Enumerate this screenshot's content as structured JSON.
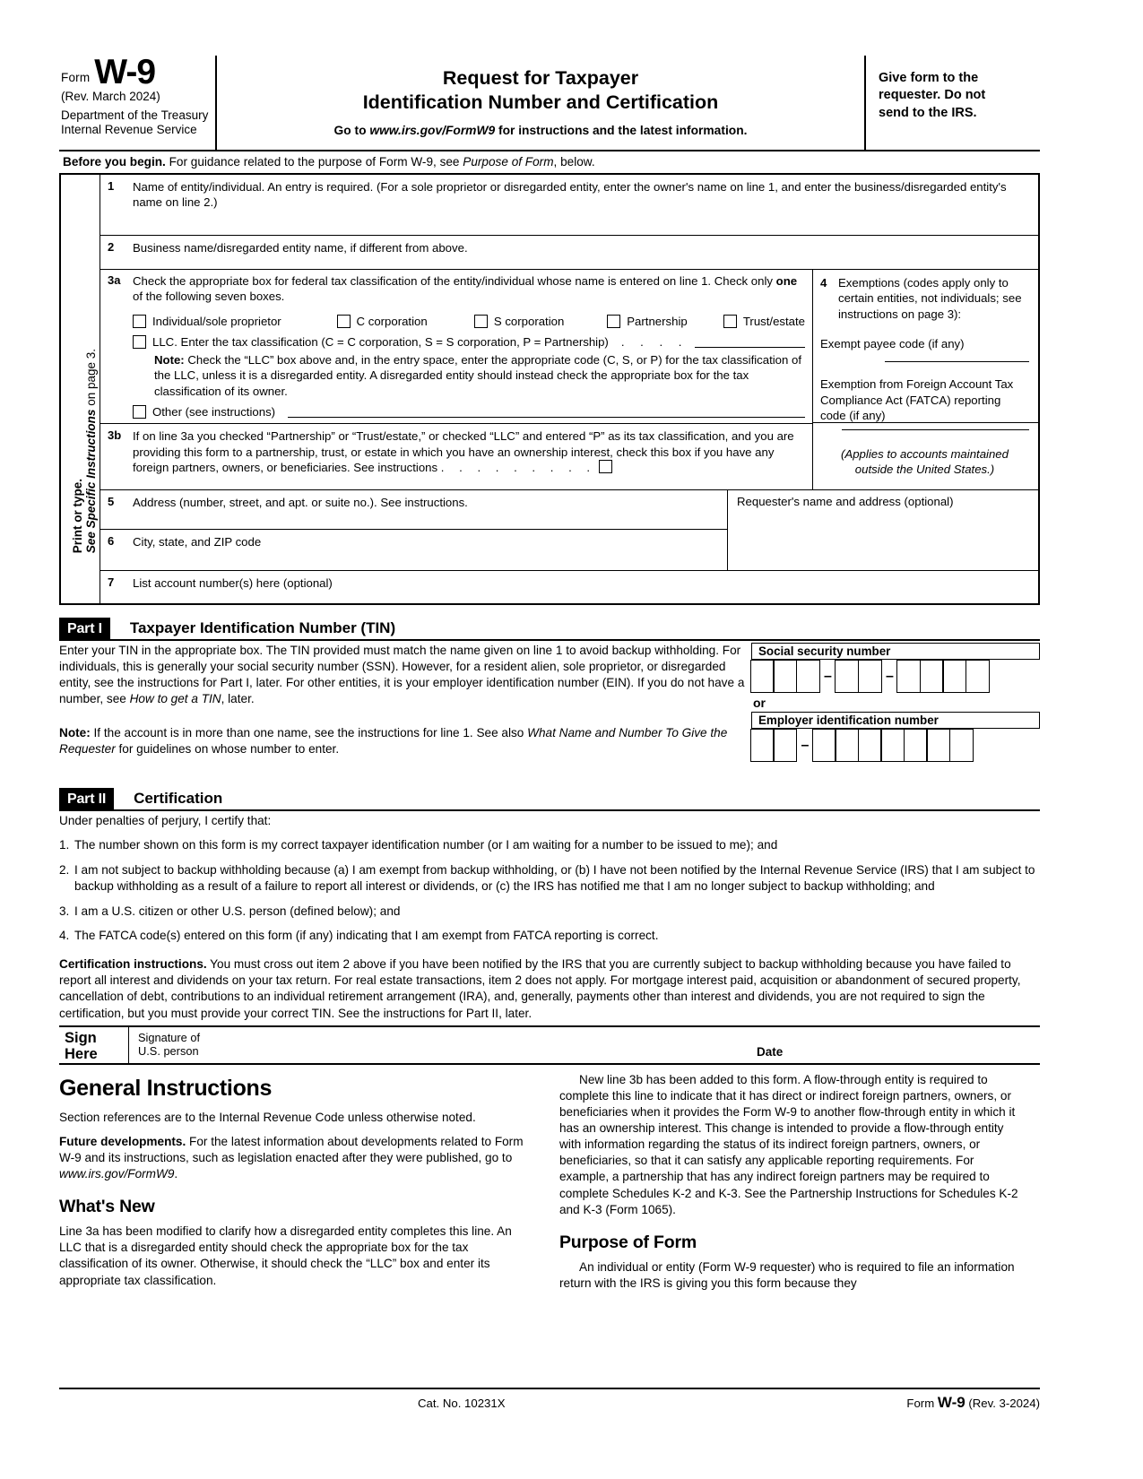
{
  "header": {
    "form_word": "Form",
    "form_number": "W-9",
    "revision": "(Rev. March 2024)",
    "dept_line1": "Department of the Treasury",
    "dept_line2": "Internal Revenue Service",
    "title_line1": "Request for Taxpayer",
    "title_line2": "Identification Number and Certification",
    "goto_prefix": "Go to ",
    "goto_url": "www.irs.gov/FormW9",
    "goto_suffix": " for instructions and the latest information.",
    "give_form_line1": "Give form to the",
    "give_form_line2": "requester. Do not",
    "give_form_line3": "send to the IRS."
  },
  "before_begin": {
    "bold": "Before you begin.",
    "text1": " For guidance related to the purpose of Form W-9, see ",
    "italic": "Purpose of Form",
    "text2": ", below."
  },
  "sidebar": {
    "line1": "Print or type.",
    "line2_italic": "See Specific Instructions",
    "line2_rest": " on page 3."
  },
  "lines": {
    "line1_num": "1",
    "line1_text": "Name of entity/individual. An entry is required. (For a sole proprietor or disregarded entity, enter the owner's name on line 1, and enter the business/disregarded entity's name on line 2.)",
    "line2_num": "2",
    "line2_text": "Business name/disregarded entity name, if different from above.",
    "line3a_num": "3a",
    "line3a_text_pre": "Check the appropriate box for federal tax classification of the entity/individual whose name is entered on line 1. Check only ",
    "line3a_bold": "one",
    "line3a_text_post": " of the following seven boxes.",
    "checkboxes": [
      {
        "label": "Individual/sole proprietor"
      },
      {
        "label": "C corporation"
      },
      {
        "label": "S corporation"
      },
      {
        "label": "Partnership"
      },
      {
        "label": "Trust/estate"
      }
    ],
    "llc_label": "LLC. Enter the tax classification (C = C corporation, S = S corporation, P = Partnership)",
    "llc_dots": ".    .    .    .",
    "note_bold": "Note:",
    "note_text": " Check the “LLC” box above and, in the entry space, enter the appropriate code (C, S, or P) for the tax classification of the LLC, unless it is a disregarded entity. A disregarded entity should instead check the appropriate box for the tax classification of its owner.",
    "other_label": "Other (see instructions)",
    "line3b_num": "3b",
    "line3b_text": "If on line 3a you checked “Partnership” or “Trust/estate,” or checked “LLC” and entered “P” as its tax classification, and you are providing this form to a partnership, trust, or estate in which you have an ownership interest, check this box if you have any foreign partners, owners, or beneficiaries. See instructions",
    "line3b_dots": ".    .    .    .    .    .    .    .    .",
    "line5_num": "5",
    "line5_text": "Address (number, street, and apt. or suite no.). See instructions.",
    "line6_num": "6",
    "line6_text": "City, state, and ZIP code",
    "line7_num": "7",
    "line7_text": "List account number(s) here (optional)",
    "requester_label": "Requester's name and address (optional)"
  },
  "exemptions": {
    "num": "4",
    "title": "Exemptions (codes apply only to certain entities, not individuals; see instructions on page 3):",
    "payee_code_label": "Exempt payee code (if any)",
    "fatca_label": "Exemption from Foreign Account Tax Compliance Act (FATCA) reporting code (if any)",
    "applies_line1": "(Applies to accounts maintained",
    "applies_line2": "outside the United States.)"
  },
  "part1": {
    "badge": "Part I",
    "title": "Taxpayer Identification Number (TIN)",
    "body_pre": "Enter your TIN in the appropriate box. The TIN provided must match the name given on line 1 to avoid backup withholding. For individuals, this is generally your social security number (SSN). However, for a resident alien, sole proprietor, or disregarded entity, see the instructions for Part I, later. For other entities, it is your employer identification number (EIN). If you do not have a number, see ",
    "body_italic": "How to get a TIN",
    "body_post": ", later.",
    "note_bold": "Note:",
    "note_pre": " If the account is in more than one name, see the instructions for line 1. See also ",
    "note_italic": "What Name and Number To Give the Requester",
    "note_post": " for guidelines on whose number to enter.",
    "ssn_label": "Social security number",
    "or_label": "or",
    "ein_label": "Employer identification number"
  },
  "part2": {
    "badge": "Part II",
    "title": "Certification",
    "intro": "Under penalties of perjury, I certify that:",
    "items": [
      {
        "num": "1.",
        "text": "The number shown on this form is my correct taxpayer identification number (or I am waiting for a number to be issued to me); and"
      },
      {
        "num": "2.",
        "text": "I am not subject to backup withholding because (a) I am exempt from backup withholding, or (b) I have not been notified by the Internal Revenue Service (IRS) that I am subject to backup withholding as a result of a failure to report all interest or dividends, or (c) the IRS has notified me that I am no longer subject to backup withholding; and"
      },
      {
        "num": "3.",
        "text": "I am a U.S. citizen or other U.S. person (defined below); and"
      },
      {
        "num": "4.",
        "text": "The FATCA code(s) entered on this form (if any) indicating that I am exempt from FATCA reporting is correct."
      }
    ],
    "cert_bold": "Certification instructions.",
    "cert_text": " You must cross out item 2 above if you have been notified by the IRS that you are currently subject to backup withholding because you have failed to report all interest and dividends on your tax return. For real estate transactions, item 2 does not apply. For mortgage interest paid, acquisition or abandonment of secured property, cancellation of debt, contributions to an individual retirement arrangement (IRA), and, generally, payments other than interest and dividends, you are not required to sign the certification, but you must provide your correct TIN. See the instructions for Part II, later."
  },
  "sign": {
    "sign_line1": "Sign",
    "sign_line2": "Here",
    "sig_line1": "Signature of",
    "sig_line2": "U.S. person",
    "date_label": "Date"
  },
  "instructions": {
    "general_heading": "General Instructions",
    "section_refs": "Section references are to the Internal Revenue Code unless otherwise noted.",
    "future_bold": "Future developments.",
    "future_pre": " For the latest information about developments related to Form W-9 and its instructions, such as legislation enacted after they were published, go to ",
    "future_italic": "www.irs.gov/FormW9",
    "future_post": ".",
    "whatsnew_heading": "What's New",
    "whatsnew_p1": "Line 3a has been modified to clarify how a disregarded entity completes this line. An LLC that is a disregarded entity should check the appropriate box for the tax classification of its owner. Otherwise, it should check the “LLC” box and enter its appropriate tax classification.",
    "whatsnew_p2": "New line 3b has been added to this form. A flow-through entity is required to complete this line to indicate that it has direct or indirect foreign partners, owners, or beneficiaries when it provides the Form W-9 to another flow-through entity in which it has an ownership interest. This change is intended to provide a flow-through entity with information regarding the status of its indirect foreign partners, owners, or beneficiaries, so that it can satisfy any applicable reporting requirements. For example, a partnership that has any indirect foreign partners may be required to complete Schedules K-2 and K-3. See the Partnership Instructions for Schedules K-2 and K-3 (Form 1065).",
    "purpose_heading": "Purpose of Form",
    "purpose_p1": "An individual or entity (Form W-9 requester) who is required to file an information return with the IRS is giving you this form because they"
  },
  "footer": {
    "cat_no": "Cat. No. 10231X",
    "form_word": "Form ",
    "form_number": "W-9",
    "rev": " (Rev. 3-2024)"
  }
}
